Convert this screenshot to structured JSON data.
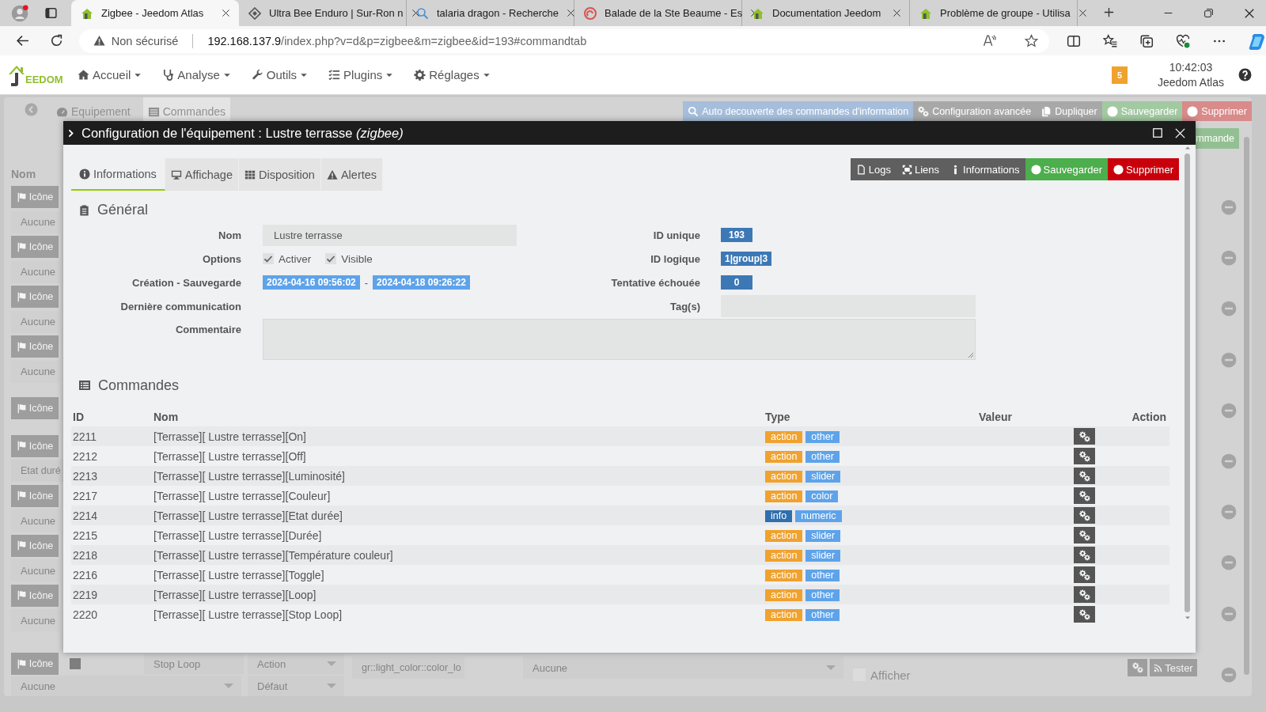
{
  "browser": {
    "tabs": [
      {
        "title": "Zigbee - Jeedom Atlas",
        "selected": true
      },
      {
        "title": "Ultra Bee Enduro | Sur-Ron n",
        "selected": false
      },
      {
        "title": "talaria dragon - Recherche",
        "selected": false
      },
      {
        "title": "Balade de la Ste Beaume - Es",
        "selected": false
      },
      {
        "title": "Documentation Jeedom",
        "selected": false
      },
      {
        "title": "Problème de groupe - Utilisa",
        "selected": false
      }
    ],
    "address": {
      "security": "Non sécurisé",
      "host": "192.168.137.9",
      "path": "/index.php?v=d&p=zigbee&m=zigbee&id=193#commandtab"
    }
  },
  "navbar": {
    "logo": "EEDOM",
    "menu": [
      "Accueil",
      "Analyse",
      "Outils",
      "Plugins",
      "Réglages"
    ],
    "badge": "5",
    "time": "10:42:03",
    "site": "Jeedom Atlas"
  },
  "background": {
    "tabs": [
      {
        "label": "Equipement",
        "selected": false
      },
      {
        "label": "Commandes",
        "selected": true
      }
    ],
    "toolbar": [
      {
        "label": "Auto decouverte des commandes d'information",
        "color": "#a6bedb"
      },
      {
        "label": "Configuration avancée",
        "color": "#a8a8a8"
      },
      {
        "label": "Dupliquer",
        "color": "#a8a8a8"
      },
      {
        "label": "Sauvegarder",
        "color": "#a3c9a3"
      },
      {
        "label": "Supprimer",
        "color": "#d98a8a"
      }
    ],
    "add_button": "mmande",
    "column_heading": "Nom",
    "left_items": [
      {
        "kind": "icon-button",
        "label": "Icône"
      },
      {
        "kind": "select",
        "label": "Aucune"
      },
      {
        "kind": "icon-button",
        "label": "Icône"
      },
      {
        "kind": "select",
        "label": "Aucune"
      },
      {
        "kind": "icon-button",
        "label": "Icône"
      },
      {
        "kind": "select",
        "label": "Aucune"
      },
      {
        "kind": "icon-button",
        "label": "Icône"
      },
      {
        "kind": "select",
        "label": "Aucune"
      },
      {
        "kind": "icon-button",
        "label": "Icône"
      },
      {
        "kind": "icon-button",
        "label": "Icône"
      },
      {
        "kind": "field",
        "label": "Etat duré"
      },
      {
        "kind": "icon-button",
        "label": "Icône"
      },
      {
        "kind": "select",
        "label": "Aucune"
      },
      {
        "kind": "icon-button",
        "label": "Icône"
      },
      {
        "kind": "select",
        "label": "Aucune"
      },
      {
        "kind": "icon-button",
        "label": "Icône"
      },
      {
        "kind": "select",
        "label": "Aucune"
      }
    ],
    "last_row": {
      "icon_button": "Icône",
      "checked": true,
      "name": "Stop Loop",
      "type": "Action",
      "icon_select": "Aucune",
      "subtype": "Défaut",
      "value": "gr::light_color::color_lo",
      "link": "Aucune",
      "show_label": "Afficher",
      "show_checked": false,
      "test_button": "Tester"
    }
  },
  "modal": {
    "title": "Configuration de l'équipement : Lustre terrasse *(zigbee)*",
    "tabs": [
      {
        "label": "Informations",
        "selected": true
      },
      {
        "label": "Affichage",
        "selected": false
      },
      {
        "label": "Disposition",
        "selected": false
      },
      {
        "label": "Alertes",
        "selected": false
      }
    ],
    "actions": [
      {
        "label": "Logs",
        "color": "#5f5f5f"
      },
      {
        "label": "Liens",
        "color": "#5f5f5f"
      },
      {
        "label": "Informations",
        "color": "#5f5f5f"
      },
      {
        "label": "Sauvegarder",
        "color": "#4cae4c"
      },
      {
        "label": "Supprimer",
        "color": "#c9000c"
      }
    ],
    "general": {
      "heading": "Général",
      "name_label": "Nom",
      "name": "Lustre terrasse",
      "options_label": "Options",
      "options": [
        {
          "label": "Activer",
          "checked": true
        },
        {
          "label": "Visible",
          "checked": true
        }
      ],
      "dates_label": "Création - Sauvegarde",
      "created": "2024-04-16 09:56:02",
      "separator": "-",
      "saved": "2024-04-18 09:26:22",
      "last_comm_label": "Dernière communication",
      "comment_label": "Commentaire",
      "unique_id_label": "ID unique",
      "unique_id": "193",
      "logical_id_label": "ID logique",
      "logical_id": "1|group|3",
      "failed_label": "Tentative échouée",
      "failed": "0",
      "tags_label": "Tag(s)"
    },
    "commands": {
      "heading": "Commandes",
      "columns": [
        "ID",
        "Nom",
        "Type",
        "Valeur",
        "Action"
      ],
      "rows": [
        {
          "id": "2211",
          "name": "[Terrasse][ Lustre terrasse][On]",
          "type": {
            "text": "action",
            "color": "#f0a22e"
          },
          "subtype": "other"
        },
        {
          "id": "2212",
          "name": "[Terrasse][ Lustre terrasse][Off]",
          "type": {
            "text": "action",
            "color": "#f0a22e"
          },
          "subtype": "other"
        },
        {
          "id": "2213",
          "name": "[Terrasse][ Lustre terrasse][Luminosité]",
          "type": {
            "text": "action",
            "color": "#f0a22e"
          },
          "subtype": "slider"
        },
        {
          "id": "2217",
          "name": "[Terrasse][ Lustre terrasse][Couleur]",
          "type": {
            "text": "action",
            "color": "#f0a22e"
          },
          "subtype": "color"
        },
        {
          "id": "2214",
          "name": "[Terrasse][ Lustre terrasse][Etat durée]",
          "type": {
            "text": "info",
            "color": "#2e6fae"
          },
          "subtype": "numeric"
        },
        {
          "id": "2215",
          "name": "[Terrasse][ Lustre terrasse][Durée]",
          "type": {
            "text": "action",
            "color": "#f0a22e"
          },
          "subtype": "slider"
        },
        {
          "id": "2218",
          "name": "[Terrasse][ Lustre terrasse][Température couleur]",
          "type": {
            "text": "action",
            "color": "#f0a22e"
          },
          "subtype": "slider"
        },
        {
          "id": "2216",
          "name": "[Terrasse][ Lustre terrasse][Toggle]",
          "type": {
            "text": "action",
            "color": "#f0a22e"
          },
          "subtype": "other"
        },
        {
          "id": "2219",
          "name": "[Terrasse][ Lustre terrasse][Loop]",
          "type": {
            "text": "action",
            "color": "#f0a22e"
          },
          "subtype": "other"
        },
        {
          "id": "2220",
          "name": "[Terrasse][ Lustre terrasse][Stop Loop]",
          "type": {
            "text": "action",
            "color": "#f0a22e"
          },
          "subtype": "other"
        }
      ]
    }
  }
}
